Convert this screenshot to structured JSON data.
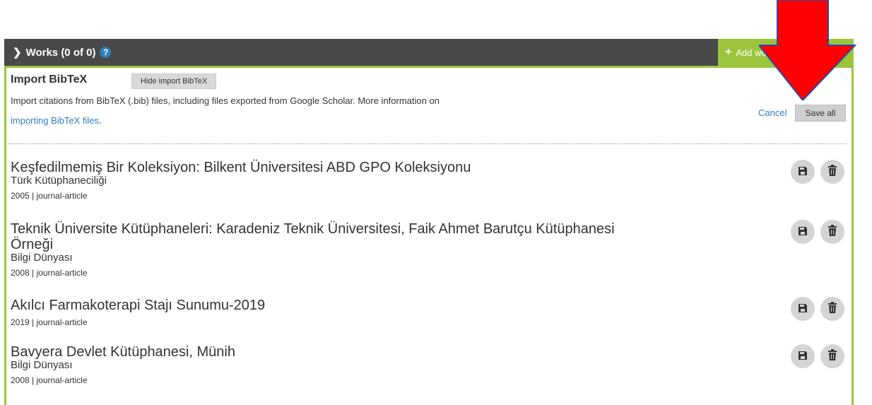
{
  "header": {
    "works_label": "Works (0 of 0)",
    "help_icon": "?",
    "add_works_label": "Add works"
  },
  "import": {
    "title": "Import BibTeX",
    "hide_label": "Hide import BibTeX",
    "description": "Import citations from BibTeX (.bib) files, including files exported from Google Scholar. More information on",
    "more_link": "importing BibTeX files",
    "more_link_suffix": ".",
    "cancel_label": "Cancel",
    "save_all_label": "Save all"
  },
  "works": [
    {
      "title": "Keşfedilmemiş Bir Koleksiyon: Bilkent Üniversitesi ABD GPO Koleksiyonu",
      "subtitle": "Türk Kütüphaneciliği",
      "meta": "2005 | journal-article"
    },
    {
      "title": "Teknik Üniversite Kütüphaneleri: Karadeniz Teknik Üniversitesi, Faik Ahmet Barutçu Kütüphanesi Örneği",
      "subtitle": "Bilgi Dünyası",
      "meta": "2008 | journal-article"
    },
    {
      "title": "Akılcı Farmakoterapi Stajı Sunumu-2019",
      "subtitle": "",
      "meta": "2019 | journal-article"
    },
    {
      "title": "Bavyera Devlet Kütüphanesi, Münih",
      "subtitle": "Bilgi Dünyası",
      "meta": "2008 | journal-article"
    }
  ],
  "icons": {
    "save": "floppy-disk-icon",
    "delete": "trash-icon",
    "chevron": "chevron-down-icon",
    "arrow": "red-down-arrow-annotation"
  },
  "colors": {
    "header_bg": "#494949",
    "accent_green": "#9bc53d",
    "link_blue": "#2e7fb8",
    "arrow_red": "#ff0000"
  }
}
